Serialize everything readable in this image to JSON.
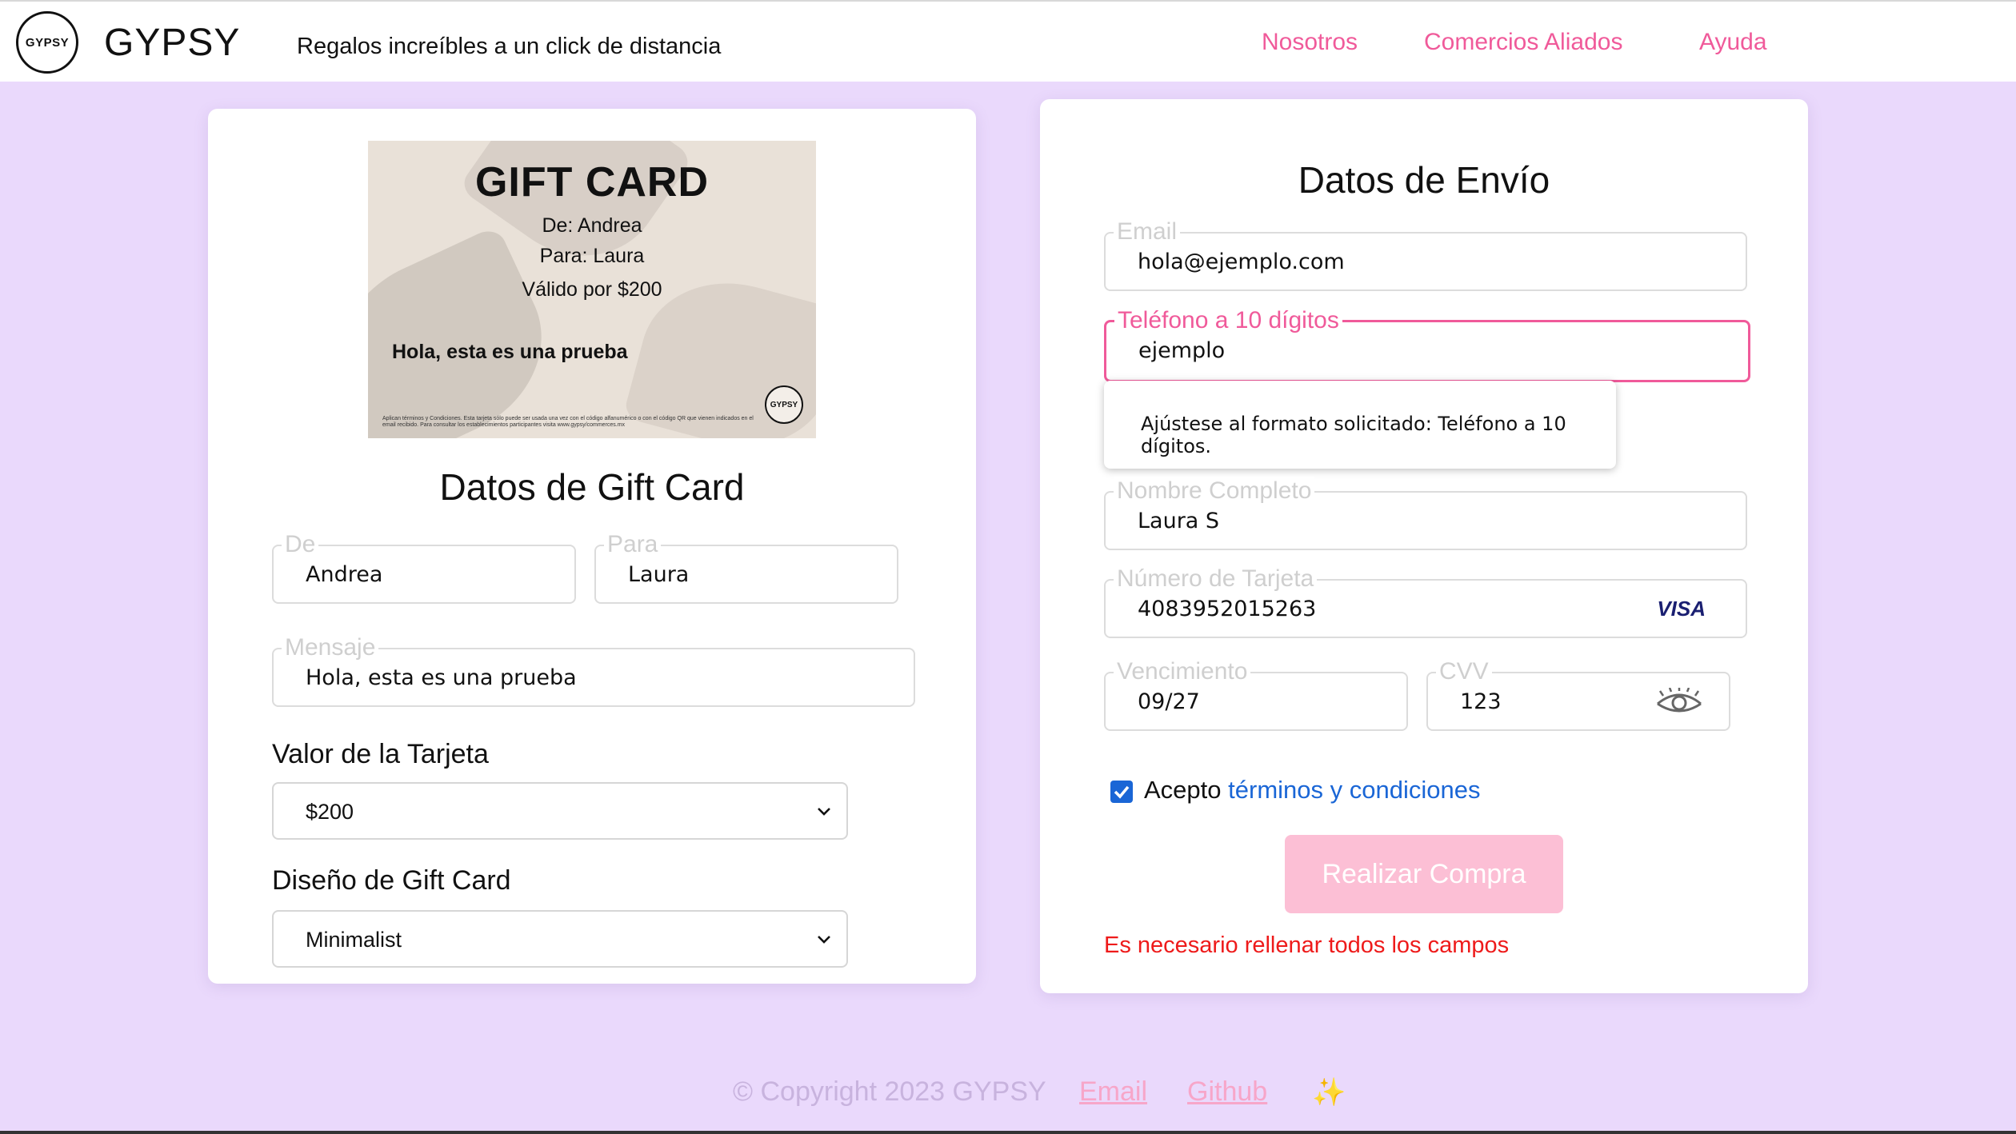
{
  "header": {
    "logo_text": "GYPSY",
    "brand": "GYPSY",
    "tagline": "Regalos increíbles a un click de distancia",
    "nav": [
      "Nosotros",
      "Comercios Aliados",
      "Ayuda"
    ]
  },
  "gift_preview": {
    "title": "GIFT CARD",
    "from_line": "De: Andrea",
    "to_line": "Para: Laura",
    "value_line": "Válido por $200",
    "message": "Hola, esta es una prueba",
    "logo_text": "GYPSY",
    "fine_print": "Aplican términos y Condiciones. Esta tarjeta sólo puede ser usada una vez con el código alfanumérico o con el código QR que vienen indicados en el email recibido. Para consultar los establecimientos participantes visita www.gypsy/commerces.mx"
  },
  "gift_form": {
    "title": "Datos de Gift Card",
    "from_label": "De",
    "from_value": "Andrea",
    "to_label": "Para",
    "to_value": "Laura",
    "message_label": "Mensaje",
    "message_value": "Hola, esta es una prueba",
    "value_label": "Valor de la Tarjeta",
    "value_selected": "$200",
    "design_label": "Diseño de Gift Card",
    "design_selected": "Minimalist"
  },
  "shipping": {
    "title": "Datos de Envío",
    "email_label": "Email",
    "email_value": "hola@ejemplo.com",
    "phone_label": "Teléfono a 10 dígitos",
    "phone_value": "ejemplo",
    "tooltip": "Ajústese al formato solicitado: Teléfono a 10 dígitos.",
    "name_label": "Nombre Completo",
    "name_value": "Laura S",
    "card_label": "Número de Tarjeta",
    "card_value": "4083952015263",
    "card_brand": "VISA",
    "exp_label": "Vencimiento",
    "exp_value": "09/27",
    "cvv_label": "CVV",
    "cvv_value": "123",
    "terms_prefix": "Acepto",
    "terms_link": "términos y condiciones",
    "terms_checked": true,
    "submit_label": "Realizar Compra",
    "error": "Es necesario rellenar todos los campos"
  },
  "footer": {
    "copyright": "© Copyright 2023 GYPSY",
    "email": "Email",
    "github": "Github",
    "sparkle": "✨"
  },
  "colors": {
    "background": "#ead9fc",
    "accent_pink": "#f05a9a",
    "button_disabled": "#fcbfd5",
    "link_blue": "#1a66d6",
    "error_red": "#ee1a1a"
  }
}
